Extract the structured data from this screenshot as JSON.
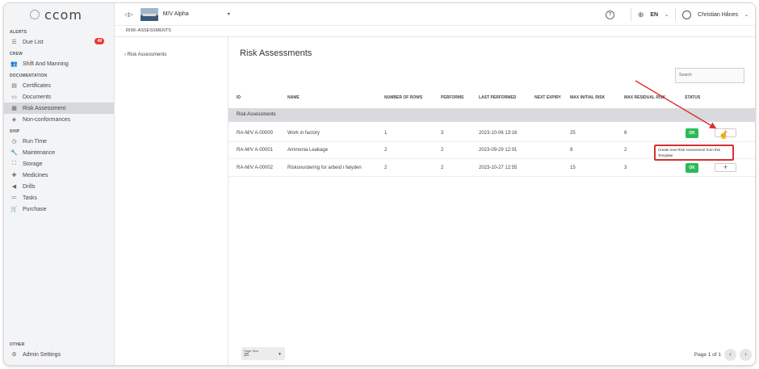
{
  "app": {
    "logo": "ccom"
  },
  "sidebar": {
    "sections": [
      {
        "title": "ALERTS"
      },
      {
        "title": "CREW"
      },
      {
        "title": "DOCUMENTATION"
      },
      {
        "title": "SHIP"
      }
    ],
    "items": {
      "due_list": {
        "label": "Due List",
        "badge": "49"
      },
      "shift": {
        "label": "Shift And Manning"
      },
      "certificates": {
        "label": "Certificates"
      },
      "documents": {
        "label": "Documents"
      },
      "risk": {
        "label": "Risk Assessment"
      },
      "nonconf": {
        "label": "Non-conformances"
      },
      "runtime": {
        "label": "Run Time"
      },
      "maintenance": {
        "label": "Maintenance"
      },
      "storage": {
        "label": "Storage"
      },
      "medicines": {
        "label": "Medicines"
      },
      "drills": {
        "label": "Drills"
      },
      "tasks": {
        "label": "Tasks"
      },
      "purchase": {
        "label": "Purchase"
      }
    },
    "other_title": "OTHER",
    "admin_label": "Admin Settings"
  },
  "topbar": {
    "vessel": "M/V Alpha",
    "language": "EN",
    "user": "Christian Hånes",
    "help": "?"
  },
  "breadcrumb": "RISK-ASSESSMENTS",
  "tree": {
    "item": "Risk Assessments"
  },
  "main": {
    "title": "Risk Assessments",
    "search_placeholder": "Search",
    "columns": {
      "id": "ID",
      "name": "NAME",
      "rows": "NUMBER OF ROWS",
      "performs": "PERFORMS",
      "last": "LAST PERFORMED",
      "next": "NEXT EXPIRY",
      "initial": "MAX INITIAL RISK",
      "residual": "MAX RESIDUAL RISK",
      "status": "STATUS"
    },
    "group": "Risk Assessments",
    "rows": [
      {
        "id": "RA-M/V A-00000",
        "name": "Work in factory",
        "rows": "1",
        "performs": "3",
        "last": "2023-10-06 13:16",
        "initial": "25",
        "residual": "6",
        "status": "OK"
      },
      {
        "id": "RA-M/V A-00001",
        "name": "Ammonia Leakage",
        "rows": "2",
        "performs": "2",
        "last": "2023-09-29 12:01",
        "initial": "8",
        "residual": "2",
        "status": ""
      },
      {
        "id": "RA-M/V A-00002",
        "name": "Riskovurdering for arbeid i høyden",
        "rows": "2",
        "performs": "2",
        "last": "2023-10-27 12:55",
        "initial": "15",
        "residual": "3",
        "status": "OK"
      }
    ],
    "add_label": "+",
    "tooltip": "Create new Risk Assessment from this Template",
    "page_size_label": "Page Size",
    "page_size_value": "25",
    "page_info": "Page 1 of 1"
  },
  "colors": {
    "accent_ok": "#2bbb55",
    "badge": "#e53935",
    "annotation": "#d9302f"
  }
}
